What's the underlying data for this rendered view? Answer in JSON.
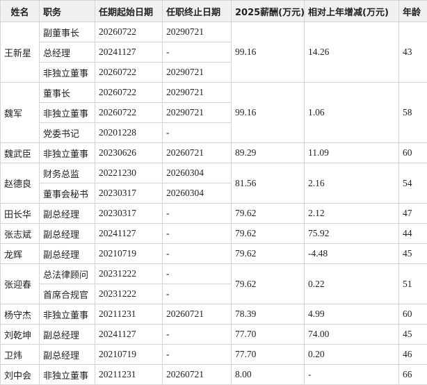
{
  "headers": [
    "姓名",
    "职务",
    "任期起始日期",
    "任职终止日期",
    "2025薪酬(万元)",
    "相对上年增减(万元)",
    "年龄"
  ],
  "people": [
    {
      "name": "王新星",
      "salary": "99.16",
      "change": "14.26",
      "age": "43",
      "roles": [
        {
          "position": "副董事长",
          "start": "20260722",
          "end": "20290721"
        },
        {
          "position": "总经理",
          "start": "20241127",
          "end": "-"
        },
        {
          "position": "非独立董事",
          "start": "20260722",
          "end": "20290721"
        }
      ]
    },
    {
      "name": "魏军",
      "salary": "99.16",
      "change": "1.06",
      "age": "58",
      "roles": [
        {
          "position": "董事长",
          "start": "20260722",
          "end": "20290721"
        },
        {
          "position": "非独立董事",
          "start": "20260722",
          "end": "20290721"
        },
        {
          "position": "党委书记",
          "start": "20201228",
          "end": "-"
        }
      ]
    },
    {
      "name": "魏武臣",
      "salary": "89.29",
      "change": "11.09",
      "age": "60",
      "roles": [
        {
          "position": "非独立董事",
          "start": "20230626",
          "end": "20260721"
        }
      ]
    },
    {
      "name": "赵德良",
      "salary": "81.56",
      "change": "2.16",
      "age": "54",
      "roles": [
        {
          "position": "财务总监",
          "start": "20221230",
          "end": "20260304"
        },
        {
          "position": "董事会秘书",
          "start": "20230317",
          "end": "20260304"
        }
      ]
    },
    {
      "name": "田长华",
      "salary": "79.62",
      "change": "2.12",
      "age": "47",
      "roles": [
        {
          "position": "副总经理",
          "start": "20230317",
          "end": "-"
        }
      ]
    },
    {
      "name": "张志斌",
      "salary": "79.62",
      "change": "75.92",
      "age": "44",
      "roles": [
        {
          "position": "副总经理",
          "start": "20241127",
          "end": "-"
        }
      ]
    },
    {
      "name": "龙辉",
      "salary": "79.62",
      "change": "-4.48",
      "age": "45",
      "roles": [
        {
          "position": "副总经理",
          "start": "20210719",
          "end": "-"
        }
      ]
    },
    {
      "name": "张迎春",
      "salary": "79.62",
      "change": "0.22",
      "age": "51",
      "roles": [
        {
          "position": "总法律顾问",
          "start": "20231222",
          "end": "-"
        },
        {
          "position": "首席合规官",
          "start": "20231222",
          "end": "-"
        }
      ]
    },
    {
      "name": "杨守杰",
      "salary": "78.39",
      "change": "4.99",
      "age": "60",
      "roles": [
        {
          "position": "非独立董事",
          "start": "20211231",
          "end": "20260721"
        }
      ]
    },
    {
      "name": "刘乾坤",
      "salary": "77.70",
      "change": "74.00",
      "age": "45",
      "roles": [
        {
          "position": "副总经理",
          "start": "20241127",
          "end": "-"
        }
      ]
    },
    {
      "name": "卫炜",
      "salary": "77.70",
      "change": "0.20",
      "age": "46",
      "roles": [
        {
          "position": "副总经理",
          "start": "20210719",
          "end": "-"
        }
      ]
    },
    {
      "name": "刘中会",
      "salary": "8.00",
      "change": "-",
      "age": "66",
      "roles": [
        {
          "position": "非独立董事",
          "start": "20211231",
          "end": "20260721"
        }
      ]
    }
  ]
}
